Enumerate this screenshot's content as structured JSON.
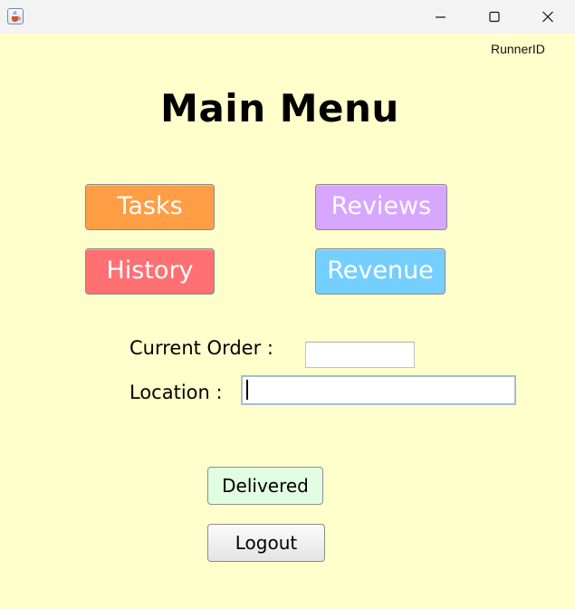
{
  "window": {
    "icon": "java-cup-icon",
    "controls": [
      "minimize-icon",
      "maximize-icon",
      "close-icon"
    ]
  },
  "header": {
    "runner_id": "RunnerID",
    "title": "Main Menu"
  },
  "menu": {
    "tasks": "Tasks",
    "reviews": "Reviews",
    "history": "History",
    "revenue": "Revenue"
  },
  "form": {
    "current_order_label": "Current Order :",
    "current_order_value": "",
    "location_label": "Location :",
    "location_value": ""
  },
  "actions": {
    "delivered": "Delivered",
    "logout": "Logout"
  },
  "colors": {
    "background": "#ffffcc",
    "tasks": "#ff9e45",
    "reviews": "#d7a6ff",
    "history": "#ff7073",
    "revenue": "#74cfff",
    "delivered": "#e1fee3"
  }
}
